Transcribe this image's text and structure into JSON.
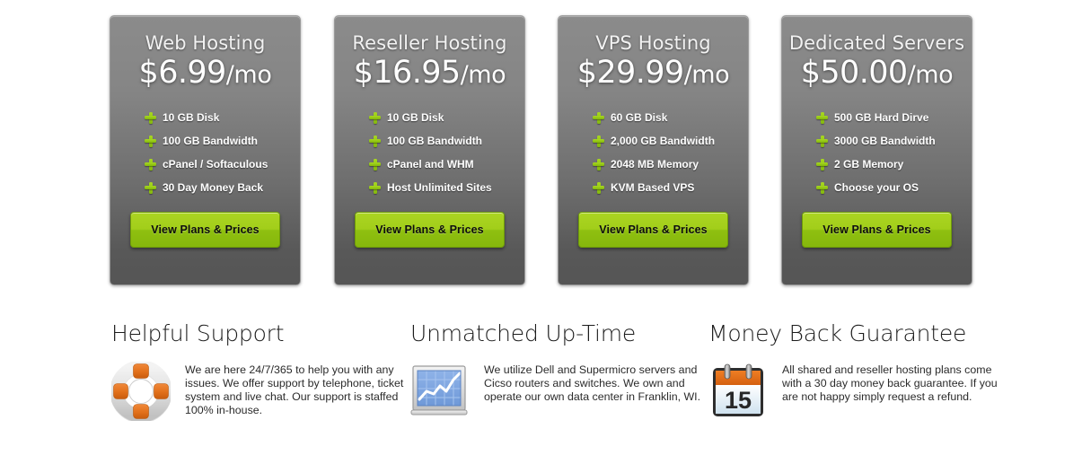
{
  "plans": [
    {
      "title": "Web Hosting",
      "price": "$6.99",
      "per": "/mo",
      "features": [
        "10 GB Disk",
        "100 GB Bandwidth",
        "cPanel / Softaculous",
        "30 Day Money Back"
      ],
      "button_label": "View Plans & Prices"
    },
    {
      "title": "Reseller Hosting",
      "price": "$16.95",
      "per": "/mo",
      "features": [
        "10 GB Disk",
        "100 GB Bandwidth",
        "cPanel and WHM",
        "Host Unlimited Sites"
      ],
      "button_label": "View Plans & Prices"
    },
    {
      "title": "VPS Hosting",
      "price": "$29.99",
      "per": "/mo",
      "features": [
        "60 GB Disk",
        "2,000 GB Bandwidth",
        "2048 MB Memory",
        "KVM Based VPS"
      ],
      "button_label": "View Plans & Prices"
    },
    {
      "title": "Dedicated Servers",
      "price": "$50.00",
      "per": "/mo",
      "features": [
        "500 GB Hard Dirve",
        "3000 GB Bandwidth",
        "2 GB Memory",
        "Choose your OS"
      ],
      "button_label": "View Plans & Prices"
    }
  ],
  "benefits": [
    {
      "heading": "Helpful Support",
      "icon": "life-ring-icon",
      "text": "We are here 24/7/365 to help you with any issues. We offer support by telephone, ticket system and live chat. Our support is staffed 100% in-house."
    },
    {
      "heading": "Unmatched Up-Time",
      "icon": "line-chart-icon",
      "text": "We utilize Dell and Supermicro servers and Cicso routers and switches. We own and operate our own data center in Franklin, WI."
    },
    {
      "heading": "Money Back Guarantee",
      "icon": "calendar-icon",
      "text": "All shared and reseller hosting plans come with a 30 day money back guarantee. If you are not happy simply request a refund.",
      "calendar_day": "15"
    }
  ],
  "colors": {
    "card_gradient_top": "#8b8b8b",
    "card_gradient_bottom": "#555555",
    "button_green_top": "#abd522",
    "button_green_bottom": "#86b70c",
    "plus_green": "#a8d820",
    "accent_orange": "#e2701a",
    "chart_blue": "#7ea6e0",
    "text_dark": "#1c1c1c"
  }
}
